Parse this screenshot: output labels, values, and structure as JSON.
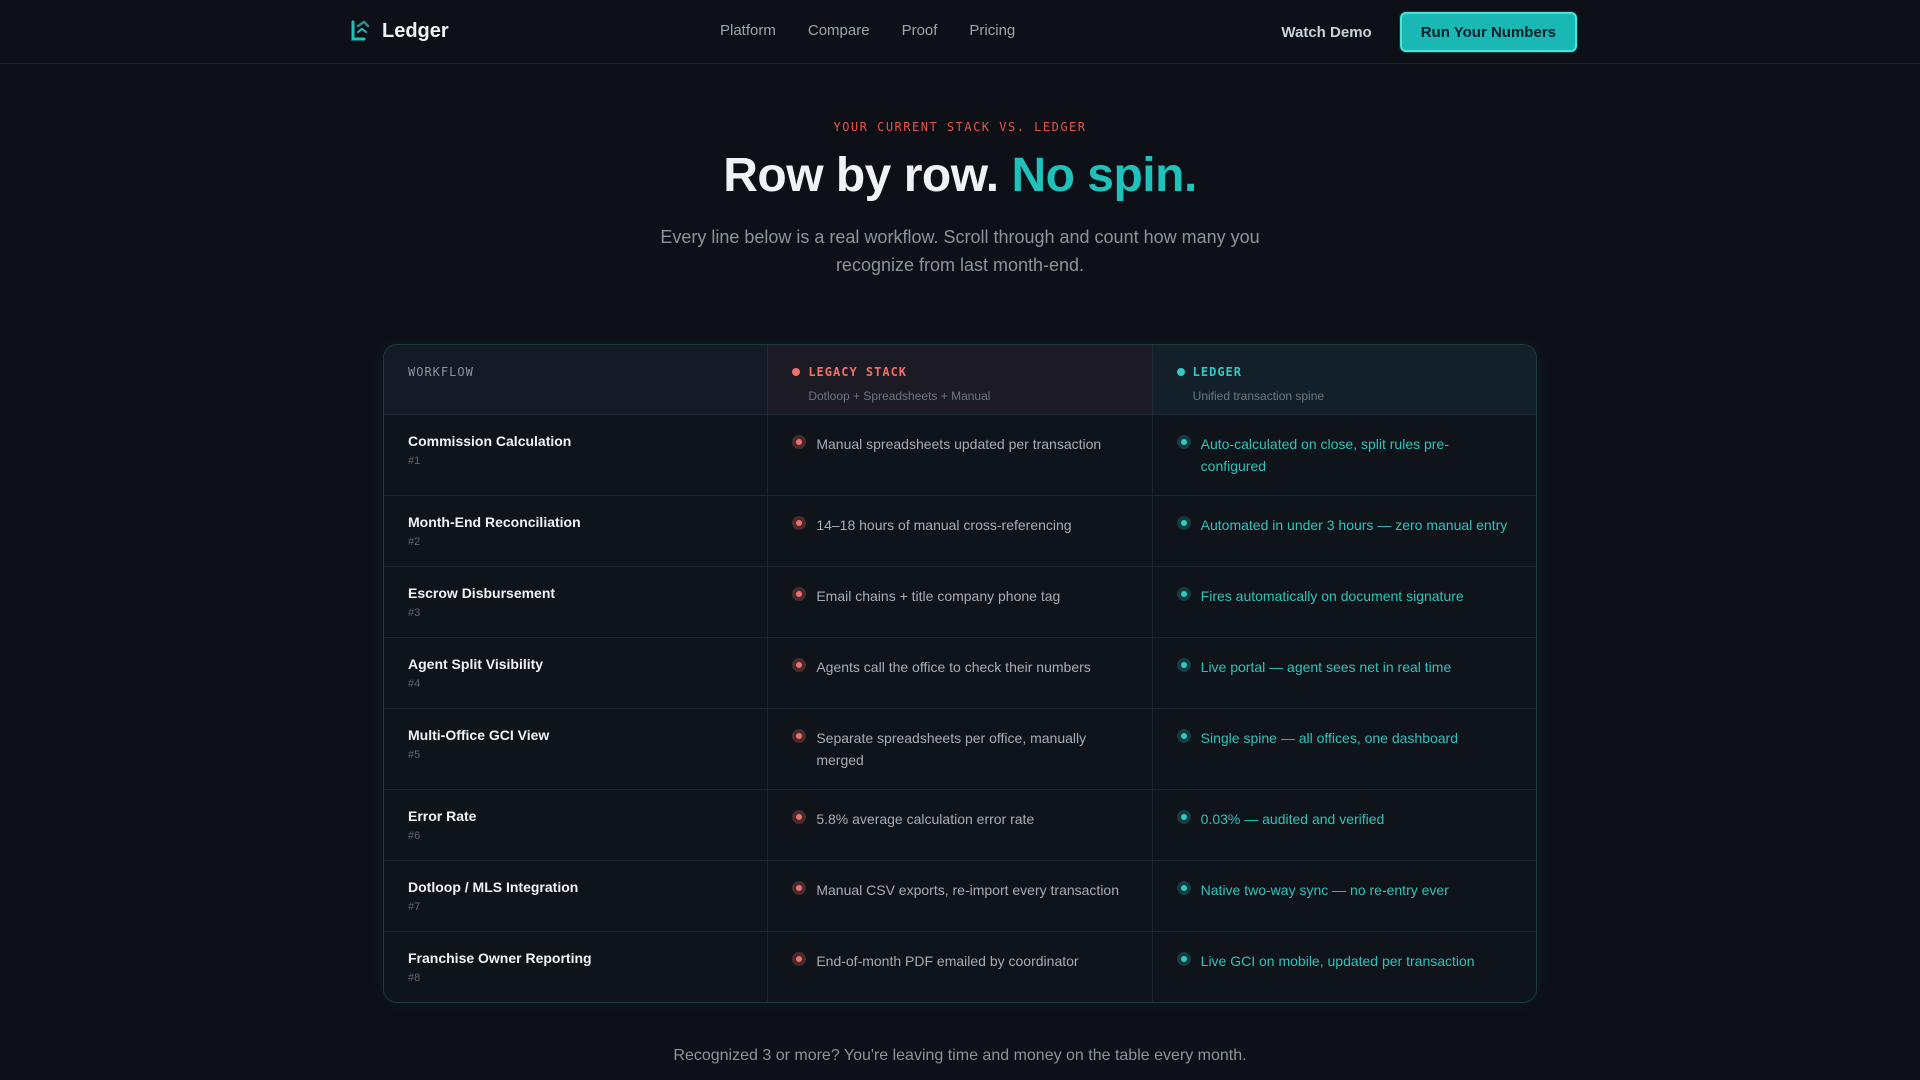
{
  "nav": {
    "brand": "Ledger",
    "links": [
      "Platform",
      "Compare",
      "Proof",
      "Pricing"
    ],
    "watch_demo": "Watch Demo",
    "cta": "Run Your Numbers"
  },
  "hero": {
    "eyebrow": "YOUR CURRENT STACK VS. LEDGER",
    "headline_main": "Row by row.",
    "headline_accent": "No spin.",
    "subhead": "Every line below is a real workflow. Scroll through and count how many you recognize from last month-end."
  },
  "table": {
    "headers": {
      "workflow": "WORKFLOW",
      "legacy": "LEGACY STACK",
      "legacy_sub": "Dotloop + Spreadsheets + Manual",
      "ledger": "LEDGER",
      "ledger_sub": "Unified transaction spine"
    },
    "rows": [
      {
        "name": "Commission Calculation",
        "num": "#1",
        "legacy": "Manual spreadsheets updated per transaction",
        "ledger": "Auto-calculated on close, split rules pre-configured"
      },
      {
        "name": "Month-End Reconciliation",
        "num": "#2",
        "legacy": "14–18 hours of manual cross-referencing",
        "ledger": "Automated in under 3 hours — zero manual entry"
      },
      {
        "name": "Escrow Disbursement",
        "num": "#3",
        "legacy": "Email chains + title company phone tag",
        "ledger": "Fires automatically on document signature"
      },
      {
        "name": "Agent Split Visibility",
        "num": "#4",
        "legacy": "Agents call the office to check their numbers",
        "ledger": "Live portal — agent sees net in real time"
      },
      {
        "name": "Multi-Office GCI View",
        "num": "#5",
        "legacy": "Separate spreadsheets per office, manually merged",
        "ledger": "Single spine — all offices, one dashboard"
      },
      {
        "name": "Error Rate",
        "num": "#6",
        "legacy": "5.8% average calculation error rate",
        "ledger": "0.03% — audited and verified"
      },
      {
        "name": "Dotloop / MLS Integration",
        "num": "#7",
        "legacy": "Manual CSV exports, re-import every transaction",
        "ledger": "Native two-way sync — no re-entry ever"
      },
      {
        "name": "Franchise Owner Reporting",
        "num": "#8",
        "legacy": "End-of-month PDF emailed by coordinator",
        "ledger": "Live GCI on mobile, updated per transaction"
      }
    ]
  },
  "footer_note": "Recognized 3 or more? You're leaving time and money on the table every month.",
  "colors": {
    "accent": "#1fc2bb",
    "danger": "#f0706a",
    "background": "#0d1117"
  }
}
